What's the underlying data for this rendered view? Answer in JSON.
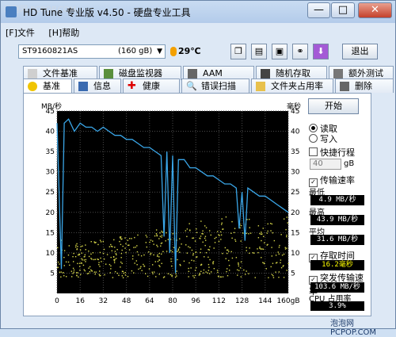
{
  "window": {
    "title": "HD Tune 专业版 v4.50 - 硬盘专业工具",
    "close_glyph": "✕",
    "minimize_glyph": "—",
    "maximize_glyph": "□"
  },
  "watermark": "泡泡网  PCPOP.COM",
  "footer_watermark": "泡泡网 PCPOP.COM",
  "menu": [
    {
      "label": "[F]文件"
    },
    {
      "label": "[H]帮助"
    }
  ],
  "toolbar": {
    "drive_name": "ST9160821AS",
    "drive_size": "(160 gB)",
    "temperature": "29℃",
    "exit_label": "退出",
    "tool_icons": [
      "copy-icon",
      "copy-text-icon",
      "save-icon",
      "compare-icon",
      "download-icon"
    ]
  },
  "tabs_row1": [
    {
      "label": "文件基准"
    },
    {
      "label": "磁盘监视器"
    },
    {
      "label": "AAM"
    },
    {
      "label": "随机存取"
    },
    {
      "label": "额外测试"
    }
  ],
  "tabs_row2": [
    {
      "label": "基准",
      "active": true
    },
    {
      "label": "信息"
    },
    {
      "label": "健康"
    },
    {
      "label": "错误扫描"
    },
    {
      "label": "文件夹占用率"
    },
    {
      "label": "删除"
    }
  ],
  "side": {
    "start_label": "开始",
    "read_label": "读取",
    "write_label": "写入",
    "short_stroke_label": "快捷行程",
    "short_stroke_value": "40",
    "transfer_rate_label": "传输速率",
    "min_label": "最低",
    "min_value": "4.9 MB/秒",
    "max_label": "最高",
    "max_value": "43.9 MB/秒",
    "avg_label": "平均",
    "avg_value": "31.6 MB/秒",
    "access_time_label": "存取时间",
    "access_time_value": "16.2毫秒",
    "burst_label": "突发传输速率",
    "burst_value": "103.6 MB/秒",
    "cpu_label": "CPU 占用率",
    "cpu_value": "3.9%"
  },
  "chart_data": {
    "type": "line",
    "ylabel_left": "MB/秒",
    "ylabel_right": "毫秒",
    "y_ticks_left": [
      45,
      40,
      35,
      30,
      25,
      20,
      15,
      10,
      5
    ],
    "y_ticks_right": [
      45,
      40,
      35,
      30,
      25,
      20,
      15,
      10,
      5
    ],
    "x_ticks": [
      "0",
      "16",
      "32",
      "48",
      "64",
      "80",
      "96",
      "112",
      "128",
      "144",
      "160gB"
    ],
    "xlim": [
      0,
      160
    ],
    "ylim": [
      0,
      45
    ],
    "series": [
      {
        "name": "传输速率",
        "x": [
          0,
          3,
          5,
          8,
          12,
          16,
          20,
          24,
          28,
          32,
          36,
          40,
          44,
          48,
          52,
          56,
          60,
          64,
          68,
          72,
          74,
          76,
          78,
          80,
          82,
          84,
          88,
          92,
          96,
          100,
          104,
          108,
          112,
          116,
          120,
          124,
          126,
          128,
          130,
          132,
          136,
          140,
          144,
          148,
          152,
          156,
          160
        ],
        "y": [
          42,
          6,
          42,
          43,
          40,
          42,
          41,
          41,
          40,
          41,
          40,
          39,
          39,
          38,
          38,
          37,
          36,
          36,
          35,
          34,
          14,
          35,
          10,
          34,
          5,
          33,
          33,
          31,
          31,
          30,
          29,
          29,
          28,
          27,
          27,
          26,
          16,
          25,
          13,
          26,
          25,
          24,
          24,
          23,
          22,
          21,
          20
        ]
      }
    ],
    "access_scatter": {
      "name": "存取时间",
      "y_range": [
        4,
        21
      ],
      "x_range": [
        0,
        160
      ]
    },
    "grid": true
  }
}
